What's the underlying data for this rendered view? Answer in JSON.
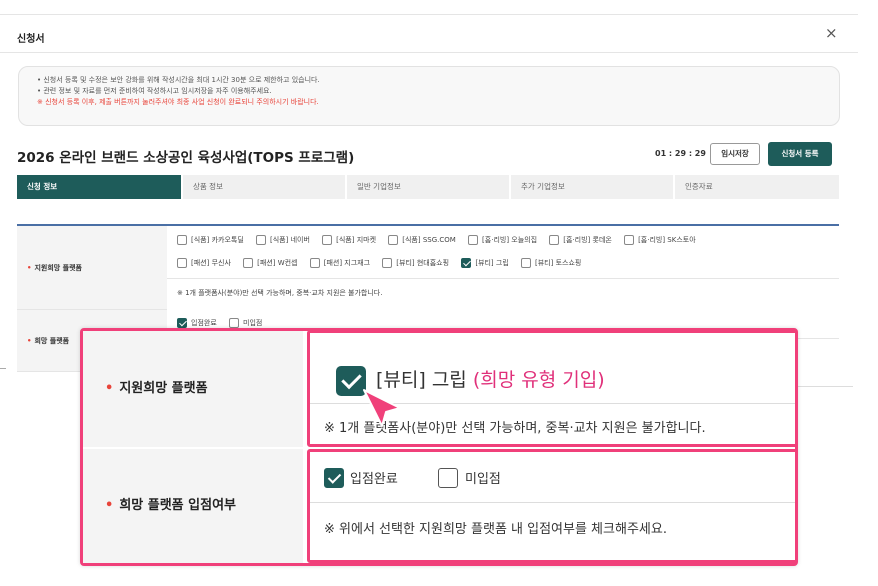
{
  "modal": {
    "title": "신청서",
    "close_icon": "×"
  },
  "notice": {
    "line1": "• 신청서 등록 및 수정은 보안 강화를 위해 작성시간을 최대 1시간 30분 으로 제한하고 있습니다.",
    "line2": "• 관련 정보 및 자료를 먼저 준비하여 작성하시고 임시저장을 자주 이용해주세요.",
    "line3": "※ 신청서 등록 이후, 제출 버튼까지 눌러주셔야 최종 사업 신청이 완료되니 주의하시기 바랍니다."
  },
  "page": {
    "heading": "2026 온라인 브랜드 소상공인 육성사업(TOPS 프로그램)",
    "timer": "01 : 29 : 29",
    "temp_save_label": "임시저장",
    "submit_label": "신청서 등록"
  },
  "tabs": [
    "신청 정보",
    "상품 정보",
    "일반 기업정보",
    "추가 기업정보",
    "인증자료"
  ],
  "form": {
    "platform_label": "지원희망 플랫폼",
    "platform_row1": [
      {
        "label": "[식품] 카카오톡딜",
        "checked": false
      },
      {
        "label": "[식품] 네이버",
        "checked": false
      },
      {
        "label": "[식품] 지마켓",
        "checked": false
      },
      {
        "label": "[식품] SSG.COM",
        "checked": false
      },
      {
        "label": "[홈·리빙] 오늘의집",
        "checked": false
      },
      {
        "label": "[홈·리빙] 롯데온",
        "checked": false
      },
      {
        "label": "[홈·리빙] SK스토아",
        "checked": false
      }
    ],
    "platform_row2": [
      {
        "label": "[패션] 무신사",
        "checked": false
      },
      {
        "label": "[패션] W컨셉",
        "checked": false
      },
      {
        "label": "[패션] 지그재그",
        "checked": false
      },
      {
        "label": "[뷰티] 현대홈쇼핑",
        "checked": false
      },
      {
        "label": "[뷰티] 그립",
        "checked": true
      },
      {
        "label": "[뷰티] 토스쇼핑",
        "checked": false
      }
    ],
    "platform_note": "※ 1개 플랫폼사(분야)만 선택 가능하며, 중복·교차 지원은 불가합니다.",
    "entry_label": "희망 플랫폼",
    "entry_options": [
      {
        "label": "입점완료",
        "checked": true
      },
      {
        "label": "미입점",
        "checked": false
      }
    ]
  },
  "zoom": {
    "platform_label": "지원희망 플랫폼",
    "selected_platform": "[뷰티] 그립",
    "annotation": "(희망 유형 기입)",
    "platform_note": "※ 1개 플랫폼사(분야)만 선택 가능하며, 중복·교차 지원은 불가합니다.",
    "entry_label": "희망 플랫폼 입점여부",
    "entry_done": "입점완료",
    "entry_not": "미입점",
    "entry_note": "※ 위에서 선택한 지원희망 플랫폼 내 입점여부를 체크해주세요."
  },
  "colors": {
    "primary": "#1e5c5a",
    "highlight": "#f0407a",
    "required": "#e8443a",
    "annotation": "#e0307a"
  }
}
